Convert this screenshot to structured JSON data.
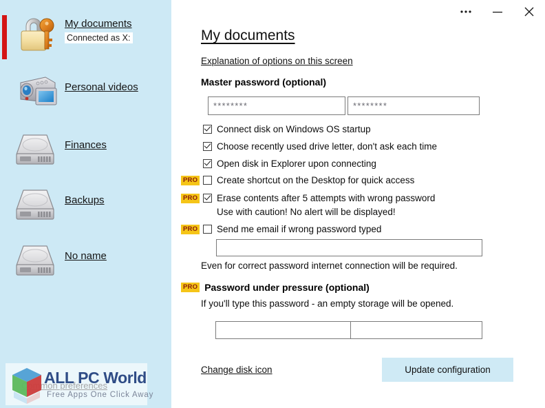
{
  "window": {
    "titlebar": {
      "more_label": "•••",
      "minimize_label": "─",
      "close_label": "✕"
    }
  },
  "sidebar": {
    "background_color": "#cde9f5",
    "selection_color": "#d41414",
    "items": [
      {
        "label": "My documents",
        "sub": "Connected as X:",
        "icon": "padlock-key-icon",
        "selected": true
      },
      {
        "label": "Personal videos",
        "sub": "",
        "icon": "camcorder-icon",
        "selected": false
      },
      {
        "label": "Finances",
        "sub": "",
        "icon": "hard-disk-icon",
        "selected": false
      },
      {
        "label": "Backups",
        "sub": "",
        "icon": "hard-disk-icon",
        "selected": false
      },
      {
        "label": "No name",
        "sub": "",
        "icon": "hard-disk-icon",
        "selected": false
      }
    ],
    "common_preferences": "Common preferences"
  },
  "watermark": {
    "title": "ALL PC World",
    "tagline": "Free Apps One Click Away"
  },
  "main": {
    "title": "My documents",
    "explanation_link": "Explanation of options on this screen",
    "master_password": {
      "heading": "Master password (optional)",
      "field1_value": "********",
      "field2_value": "********",
      "placeholder": ""
    },
    "options": [
      {
        "label": "Connect disk on Windows OS startup",
        "checked": true,
        "pro": false,
        "pro_label": ""
      },
      {
        "label": "Choose recently used drive letter, don't ask each time",
        "checked": true,
        "pro": false,
        "pro_label": ""
      },
      {
        "label": "Open disk in Explorer upon connecting",
        "checked": true,
        "pro": false,
        "pro_label": ""
      },
      {
        "label": "Create shortcut on the Desktop for quick access",
        "checked": false,
        "pro": true,
        "pro_label": "PRO"
      },
      {
        "label": "Erase contents after 5 attempts with wrong password",
        "checked": true,
        "pro": true,
        "pro_label": "PRO"
      },
      {
        "label": "Send me email if wrong password typed",
        "checked": false,
        "pro": true,
        "pro_label": "PRO"
      }
    ],
    "erase_caution_note": "Use with caution! No alert will be displayed!",
    "email_field_value": "",
    "email_note": "Even for correct password internet connection will be required.",
    "pressure": {
      "pro_label": "PRO",
      "heading": "Password under pressure (optional)",
      "note": "If you'll type this password - an empty storage will be opened.",
      "field1_value": "",
      "field2_value": ""
    },
    "change_disk_icon_link": "Change disk icon",
    "update_button": "Update configuration",
    "accent_color": "#cfeaf5",
    "pro_badge_color": "#f5c518"
  }
}
